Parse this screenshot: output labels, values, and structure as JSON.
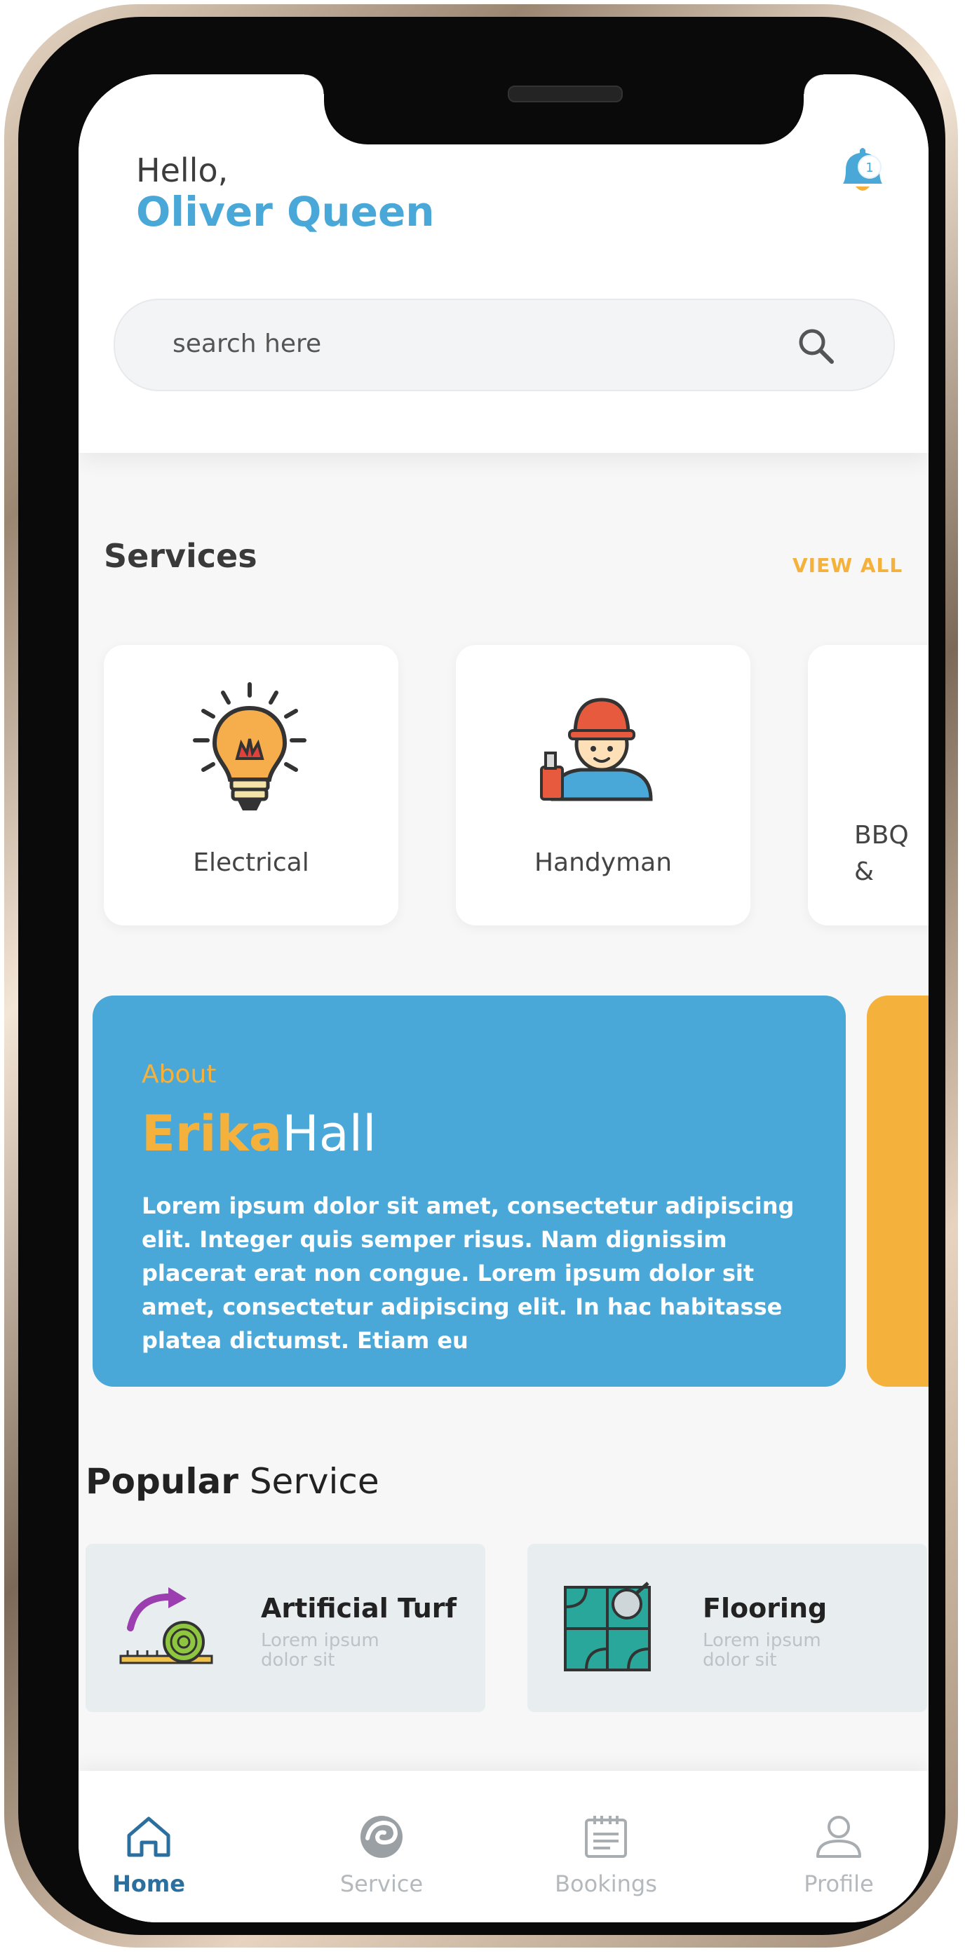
{
  "header": {
    "greeting": "Hello,",
    "user_name": "Oliver Queen",
    "notification_count": "1"
  },
  "search": {
    "placeholder": "search here"
  },
  "services": {
    "title": "Services",
    "view_all": "VIEW ALL",
    "items": [
      {
        "label": "Electrical",
        "icon": "lightbulb-icon"
      },
      {
        "label": "Handyman",
        "icon": "worker-icon"
      },
      {
        "label": "BBQ\n&",
        "icon": "bbq-icon"
      }
    ]
  },
  "about": {
    "kicker": "About",
    "first_name": "Erika",
    "last_name": "Hall",
    "body": "Lorem ipsum dolor sit amet, consectetur adipiscing elit. Integer quis semper risus. Nam dignissim placerat erat non congue. Lorem ipsum dolor sit amet, consectetur adipiscing elit. In hac habitasse platea dictumst. Etiam eu"
  },
  "popular": {
    "title_bold": "Popular",
    "title_rest": " Service",
    "items": [
      {
        "name": "Artificial Turf",
        "desc": "Lorem ipsum dolor sit",
        "icon": "turf-roll-icon"
      },
      {
        "name": "Flooring",
        "desc": "Lorem ipsum dolor sit",
        "icon": "flooring-icon"
      }
    ]
  },
  "nav": {
    "items": [
      {
        "label": "Home",
        "icon": "home-icon",
        "active": true
      },
      {
        "label": "Service",
        "icon": "service-icon",
        "active": false
      },
      {
        "label": "Bookings",
        "icon": "calendar-icon",
        "active": false
      },
      {
        "label": "Profile",
        "icon": "profile-icon",
        "active": false
      }
    ]
  },
  "colors": {
    "primary_blue": "#4aa8d8",
    "accent_orange": "#f4b13b",
    "active_nav": "#2b6f9f"
  }
}
